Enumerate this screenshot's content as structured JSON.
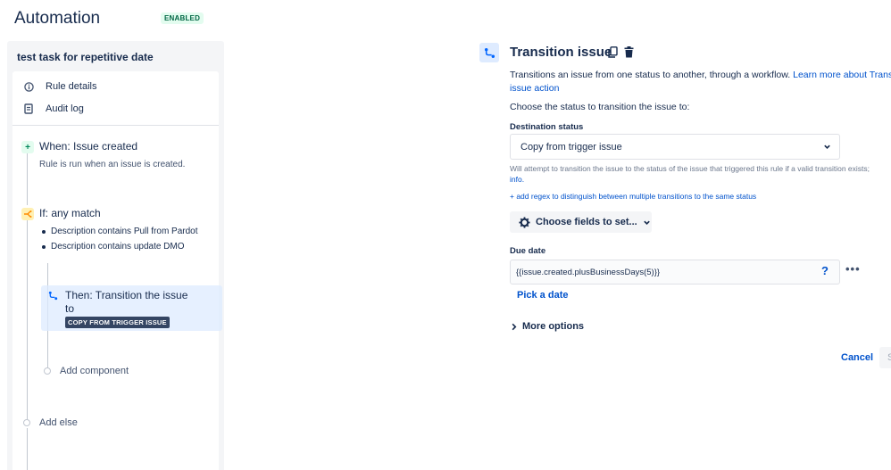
{
  "header": {
    "title": "Automation",
    "status": "ENABLED"
  },
  "rule": {
    "name": "test task for repetitive date",
    "nav": {
      "rule_details": "Rule details",
      "audit_log": "Audit log"
    },
    "trigger": {
      "title": "When: Issue created",
      "desc": "Rule is run when an issue is created."
    },
    "condition": {
      "title": "If: any match",
      "items": [
        "Description contains Pull from Pardot",
        "Description contains update DMO"
      ]
    },
    "action": {
      "title_line1": "Then: Transition the issue",
      "title_line2": "to",
      "badge": "COPY FROM TRIGGER ISSUE"
    },
    "add_component": "Add component",
    "add_else": "Add else"
  },
  "panel": {
    "title": "Transition issue",
    "desc_text": "Transitions an issue from one status to another, through a workflow. ",
    "desc_link1": "Learn more about Transit",
    "desc_link2": "issue action",
    "choose_status": "Choose the status to transition the issue to:",
    "destination_label": "Destination status",
    "destination_value": "Copy from trigger issue",
    "help_text": "Will attempt to transition the issue to the status of the issue that triggered this rule if a valid transition exists;",
    "help_link": "info.",
    "regex_link": "+ add regex to distinguish between multiple transitions to the same status",
    "choose_fields": "Choose fields to set...",
    "due_label": "Due date",
    "due_value": "{{issue.created.plusBusinessDays(5)}}",
    "help_q": "?",
    "pick_date": "Pick a date",
    "more_options": "More options",
    "cancel": "Cancel",
    "save": "S"
  },
  "colors": {
    "accent": "#0052cc",
    "enabled_bg": "#e3fcef",
    "enabled_fg": "#006644"
  },
  "icons": [
    "info-icon",
    "audit-log-icon",
    "plus-icon",
    "branch-icon",
    "transition-icon",
    "copy-icon",
    "trash-icon",
    "chevron-down-icon",
    "gear-icon",
    "chevron-right-icon"
  ]
}
